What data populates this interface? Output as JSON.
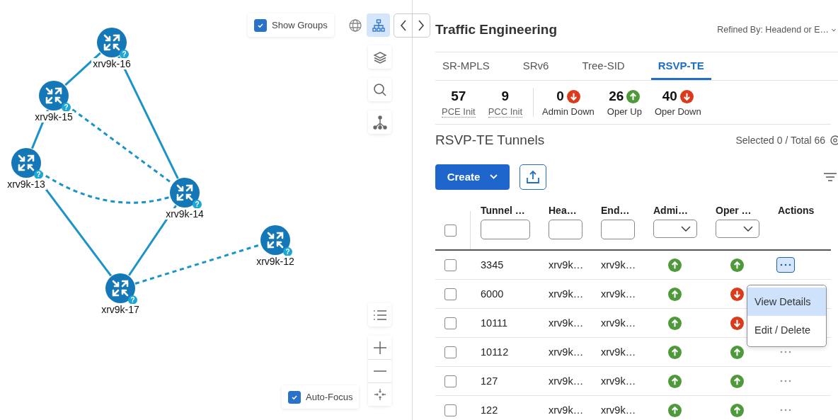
{
  "map": {
    "show_groups": {
      "label": "Show Groups",
      "checked": true
    },
    "view_toggle": [
      {
        "kind": "globe",
        "selected": false
      },
      {
        "kind": "topology",
        "selected": true
      }
    ],
    "nodes": [
      {
        "label": "xrv9k-16",
        "badge": "?"
      },
      {
        "label": "xrv9k-15",
        "badge": "?"
      },
      {
        "label": "xrv9k-13",
        "badge": "?"
      },
      {
        "label": "xrv9k-14",
        "badge": "?"
      },
      {
        "label": "xrv9k-12",
        "badge": "?"
      },
      {
        "label": "xrv9k-17",
        "badge": "?"
      }
    ],
    "links": [
      {
        "kind": "solid"
      },
      {
        "kind": "solid"
      },
      {
        "kind": "solid"
      },
      {
        "kind": "dashed"
      },
      {
        "kind": "dashed"
      },
      {
        "kind": "solid"
      },
      {
        "kind": "solid"
      },
      {
        "kind": "dashed"
      }
    ],
    "auto_focus": {
      "label": "Auto-Focus",
      "checked": true
    }
  },
  "panel": {
    "title": "Traffic Engineering",
    "refined_by": "Refined By: Headend or E…",
    "tabs": [
      {
        "label": "SR-MPLS",
        "selected": false
      },
      {
        "label": "SRv6",
        "selected": false
      },
      {
        "label": "Tree-SID",
        "selected": false
      },
      {
        "label": "RSVP-TE",
        "selected": true
      }
    ],
    "stats": [
      {
        "value": "57",
        "label": "PCE Init",
        "kind": "plain"
      },
      {
        "value": "9",
        "label": "PCC Init",
        "kind": "plain"
      },
      {
        "value": "0",
        "label": "Admin Down",
        "kind": "down"
      },
      {
        "value": "26",
        "label": "Oper Up",
        "kind": "up"
      },
      {
        "value": "40",
        "label": "Oper Down",
        "kind": "down"
      }
    ],
    "table_title": "RSVP-TE Tunnels",
    "selection": "Selected 0 / Total 66",
    "create_label": "Create",
    "select_all": {
      "checked": false
    },
    "columns": [
      {
        "label": "Tunnel …",
        "kind": "text"
      },
      {
        "label": "Hea…",
        "kind": "text"
      },
      {
        "label": "End…",
        "kind": "text"
      },
      {
        "label": "Admi…",
        "kind": "select"
      },
      {
        "label": "Oper …",
        "kind": "select"
      },
      {
        "label": "Actions",
        "kind": "plain"
      }
    ],
    "rows": [
      {
        "checked": false,
        "tunnel": "3345",
        "headend": "xrv9k…",
        "endpoint": "xrv9k…",
        "admin_up": true,
        "oper_up": true,
        "menu_open": true
      },
      {
        "checked": false,
        "tunnel": "6000",
        "headend": "xrv9k…",
        "endpoint": "xrv9k…",
        "admin_up": true,
        "oper_up": false,
        "menu_open": false
      },
      {
        "checked": false,
        "tunnel": "10111",
        "headend": "xrv9k…",
        "endpoint": "xrv9k…",
        "admin_up": true,
        "oper_up": false,
        "menu_open": false
      },
      {
        "checked": false,
        "tunnel": "10112",
        "headend": "xrv9k…",
        "endpoint": "xrv9k…",
        "admin_up": true,
        "oper_up": true,
        "menu_open": false
      },
      {
        "checked": false,
        "tunnel": "127",
        "headend": "xrv9k…",
        "endpoint": "xrv9k…",
        "admin_up": true,
        "oper_up": true,
        "menu_open": false
      },
      {
        "checked": false,
        "tunnel": "122",
        "headend": "xrv9k…",
        "endpoint": "xrv9k…",
        "admin_up": true,
        "oper_up": true,
        "menu_open": false
      }
    ],
    "menu": [
      {
        "label": "View Details",
        "selected": true
      },
      {
        "label": "Edit / Delete",
        "selected": false
      }
    ]
  }
}
